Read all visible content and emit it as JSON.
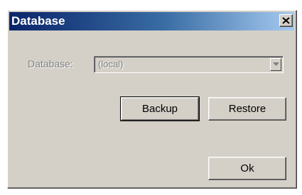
{
  "dialog": {
    "title": "Database",
    "close_icon": "close-icon"
  },
  "database_field": {
    "label": "Database:",
    "value": "(local)",
    "dropdown_icon": "chevron-down-icon"
  },
  "buttons": {
    "backup": "Backup",
    "restore": "Restore",
    "ok": "Ok"
  }
}
